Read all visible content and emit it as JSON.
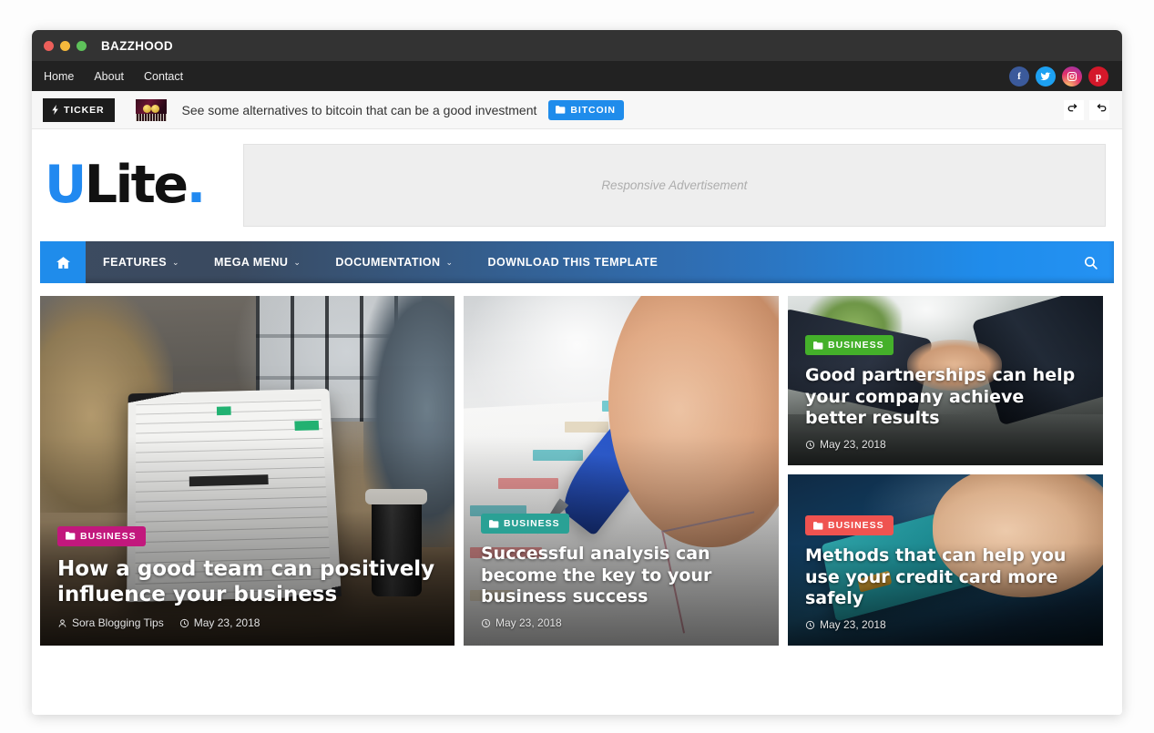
{
  "window": {
    "title": "BAZZHOOD",
    "traffic_lights": [
      "close-red",
      "minimize-yellow",
      "maximize-green"
    ]
  },
  "topbar": {
    "links": [
      {
        "label": "Home"
      },
      {
        "label": "About"
      },
      {
        "label": "Contact"
      }
    ],
    "socials": [
      {
        "name": "facebook-icon",
        "glyph": "f",
        "color": "#3b5a9b"
      },
      {
        "name": "twitter-icon",
        "glyph": "t",
        "color": "#1da1f2"
      },
      {
        "name": "instagram-icon",
        "glyph": "o",
        "color": "#e1306c"
      },
      {
        "name": "pinterest-icon",
        "glyph": "p",
        "color": "#d4182a"
      }
    ]
  },
  "ticker": {
    "badge_label": "TICKER",
    "badge_icon": "bolt-icon",
    "thumbnail": "bitcoin-coins-thumbnail",
    "headline": "See some alternatives to bitcoin that can be a good investment",
    "category_label": "BITCOIN",
    "category_icon": "folder-icon",
    "category_color": "#1f8ceb",
    "prev_icon": "prev-arrow-icon",
    "next_icon": "next-arrow-icon"
  },
  "header": {
    "logo": {
      "part1": "U",
      "part2": "Lite",
      "part3": ".",
      "accent": "#2189f0"
    },
    "ad_label": "Responsive Advertisement"
  },
  "menubar": {
    "home_icon": "home-icon",
    "items": [
      {
        "label": "FEATURES",
        "caret": "⌄"
      },
      {
        "label": "MEGA MENU",
        "caret": "⌄"
      },
      {
        "label": "DOCUMENTATION",
        "caret": "⌄"
      },
      {
        "label": "DOWNLOAD THIS TEMPLATE",
        "caret": ""
      }
    ],
    "search_icon": "search-icon",
    "gradient_from": "#3c4b60",
    "gradient_to": "#2492f3"
  },
  "featured": {
    "cards": [
      {
        "category": "BUSINESS",
        "category_color": "#c2187d",
        "title": "How a good team can positively influence your business",
        "author": "Sora Blogging Tips",
        "date": "May 23, 2018",
        "image": "team-with-laptop-photo"
      },
      {
        "category": "BUSINESS",
        "category_color": "#2aa195",
        "title": "Successful analysis can become the key to your business success",
        "author": "",
        "date": "May 23, 2018",
        "image": "hand-with-pen-on-chart-photo"
      },
      {
        "category": "BUSINESS",
        "category_color": "#44b02a",
        "title": "Good partnerships can help your company achieve better results",
        "author": "",
        "date": "May 23, 2018",
        "image": "handshake-photo"
      },
      {
        "category": "BUSINESS",
        "category_color": "#ef5350",
        "title": "Methods that can help you use your credit card more safely",
        "author": "",
        "date": "May 23, 2018",
        "image": "credit-card-photo"
      }
    ]
  }
}
